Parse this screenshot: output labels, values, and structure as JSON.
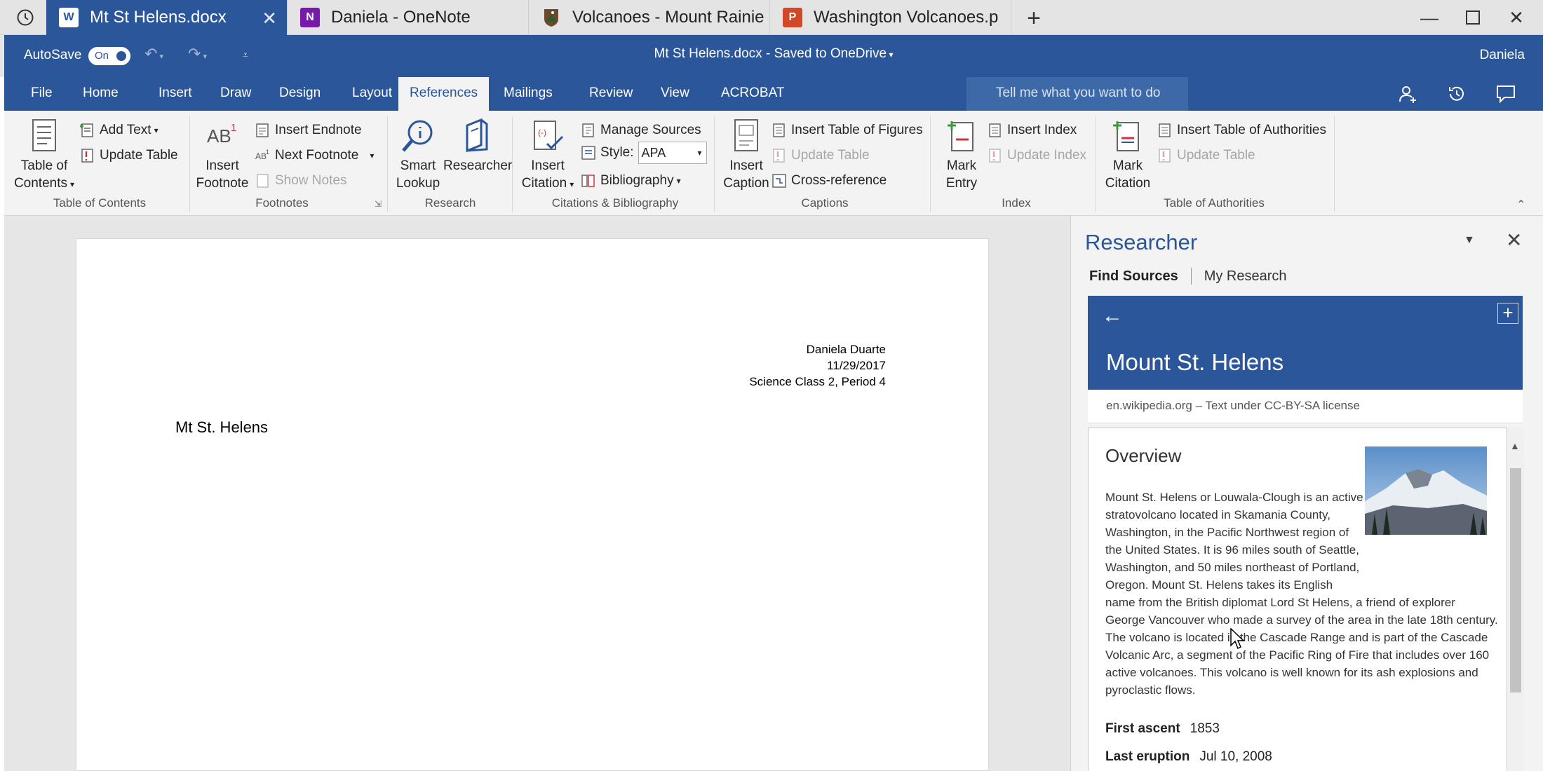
{
  "tabs": [
    {
      "label": "Mt St Helens.docx",
      "app": "W",
      "color": "#2b579a"
    },
    {
      "label": "Daniela - OneNote",
      "app": "N",
      "color": "#7719aa"
    },
    {
      "label": "Volcanoes - Mount Rainie",
      "app": "",
      "color": "#6b4a2b"
    },
    {
      "label": "Washington Volcanoes.p",
      "app": "P",
      "color": "#d24726"
    }
  ],
  "titlebar": {
    "autosave_label": "AutoSave",
    "autosave_state": "On",
    "doc_title": "Mt St Helens.docx - Saved to OneDrive",
    "user": "Daniela"
  },
  "ribbon_tabs": [
    "File",
    "Home",
    "Insert",
    "Draw",
    "Design",
    "Layout",
    "References",
    "Mailings",
    "Review",
    "View",
    "ACROBAT"
  ],
  "active_ribbon_tab": "References",
  "tell_me": "Tell me what you want to do",
  "ribbon": {
    "toc": {
      "big": "Table of Contents",
      "add_text": "Add Text",
      "update_table": "Update Table",
      "group": "Table of Contents"
    },
    "footnotes": {
      "big": "Insert Footnote",
      "insert_endnote": "Insert Endnote",
      "next_footnote": "Next Footnote",
      "show_notes": "Show Notes",
      "group": "Footnotes"
    },
    "research": {
      "smart_lookup": "Smart Lookup",
      "researcher": "Researcher",
      "group": "Research"
    },
    "citations": {
      "big": "Insert Citation",
      "manage_sources": "Manage Sources",
      "style_label": "Style:",
      "style_value": "APA",
      "bibliography": "Bibliography",
      "group": "Citations & Bibliography"
    },
    "captions": {
      "big": "Insert Caption",
      "insert_tof": "Insert Table of Figures",
      "update_table": "Update Table",
      "cross_reference": "Cross-reference",
      "group": "Captions"
    },
    "index": {
      "big": "Mark Entry",
      "insert_index": "Insert Index",
      "update_index": "Update Index",
      "group": "Index"
    },
    "toa": {
      "big": "Mark Citation",
      "insert_toa": "Insert Table of Authorities",
      "update_table": "Update Table",
      "group": "Table of Authorities"
    }
  },
  "document": {
    "header_lines": [
      "Daniela Duarte",
      "11/29/2017",
      "Science Class 2, Period 4"
    ],
    "heading": "Mt St. Helens"
  },
  "researcher": {
    "title": "Researcher",
    "tab_find": "Find Sources",
    "tab_my": "My Research",
    "card_title": "Mount St. Helens",
    "source": "en.wikipedia.org",
    "license": "Text under CC-BY-SA license",
    "overview_title": "Overview",
    "overview_text": "Mount St. Helens or Louwala-Clough is an active stratovolcano located in Skamania County, Washington, in the Pacific Northwest region of the United States. It is 96 miles south of Seattle, Washington, and 50 miles northeast of Portland, Oregon. Mount St. Helens takes its English name from the British diplomat Lord St Helens, a friend of explorer George Vancouver who made a survey of the area in the late 18th century. The volcano is located in the Cascade Range and is part of the Cascade Volcanic Arc, a segment of the Pacific Ring of Fire that includes over 160 active volcanoes. This volcano is well known for its ash explosions and pyroclastic flows.",
    "facts": [
      {
        "label": "First ascent",
        "value": "1853"
      },
      {
        "label": "Last eruption",
        "value": "Jul 10, 2008"
      }
    ]
  },
  "colors": {
    "word_blue": "#2b579a",
    "onenote_purple": "#7719aa",
    "ppt_orange": "#d24726"
  }
}
